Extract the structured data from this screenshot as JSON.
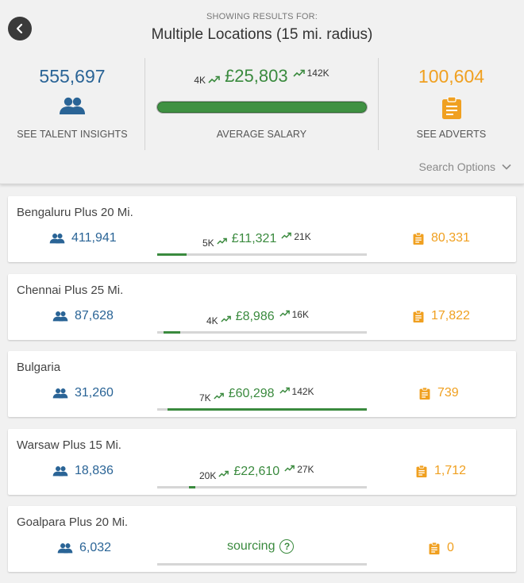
{
  "header": {
    "subheading": "SHOWING RESULTS FOR:",
    "title": "Multiple Locations (15 mi. radius)"
  },
  "summary": {
    "talent": {
      "count": "555,697",
      "label": "SEE TALENT INSIGHTS",
      "icon": "people-icon"
    },
    "salary": {
      "low": "4K",
      "average": "£25,803",
      "high": "142K",
      "label": "AVERAGE SALARY",
      "range_fill": [
        0.0,
        1.0
      ]
    },
    "adverts": {
      "count": "100,604",
      "label": "SEE ADVERTS",
      "icon": "clipboard-icon"
    }
  },
  "search_options": {
    "label": "Search Options"
  },
  "colors": {
    "blue": "#2a6496",
    "green": "#3a8a3e",
    "orange": "#f0a020"
  },
  "locations": [
    {
      "name": "Bengaluru Plus 20 Mi.",
      "talent": "411,941",
      "low": "5K",
      "average": "£11,321",
      "high": "21K",
      "adverts": "80,331",
      "range_fill": [
        0.0,
        0.14
      ]
    },
    {
      "name": "Chennai Plus 25 Mi.",
      "talent": "87,628",
      "low": "4K",
      "average": "£8,986",
      "high": "16K",
      "adverts": "17,822",
      "range_fill": [
        0.03,
        0.11
      ]
    },
    {
      "name": "Bulgaria",
      "talent": "31,260",
      "low": "7K",
      "average": "£60,298",
      "high": "142K",
      "adverts": "739",
      "range_fill": [
        0.05,
        1.0
      ]
    },
    {
      "name": "Warsaw Plus 15 Mi.",
      "talent": "18,836",
      "low": "20K",
      "average": "£22,610",
      "high": "27K",
      "adverts": "1,712",
      "range_fill": [
        0.15,
        0.18
      ]
    },
    {
      "name": "Goalpara Plus 20 Mi.",
      "talent": "6,032",
      "sourcing_label": "sourcing",
      "help_symbol": "?",
      "adverts": "0"
    }
  ]
}
